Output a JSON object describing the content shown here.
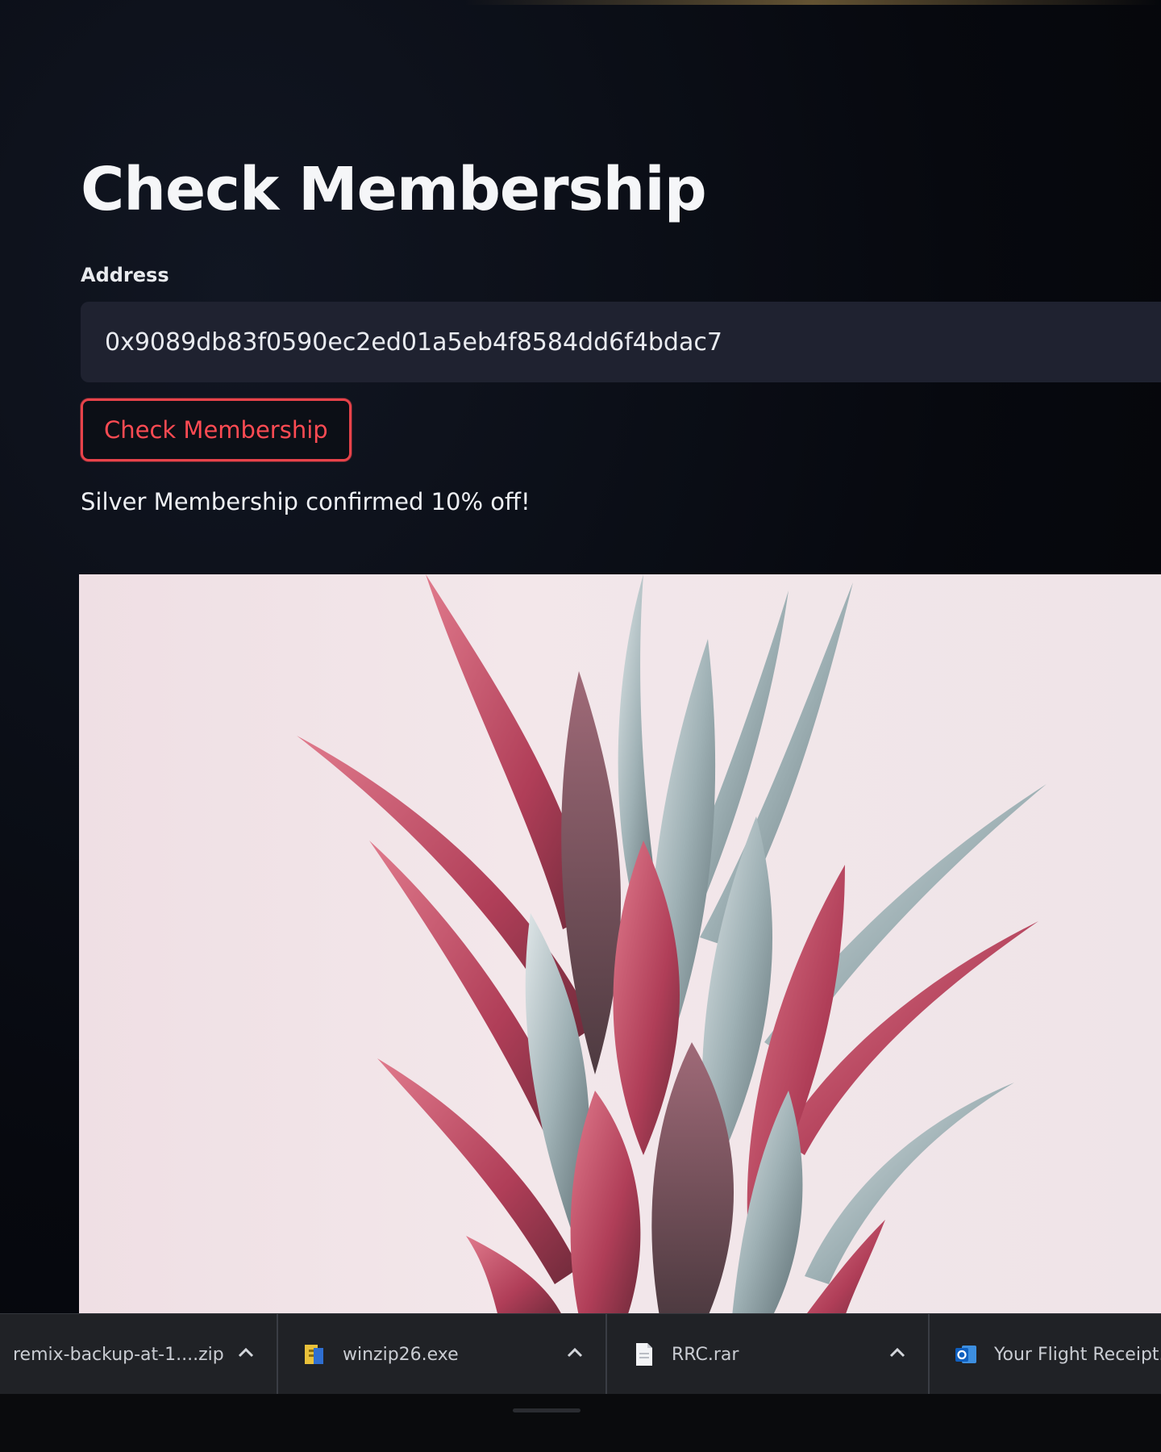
{
  "page": {
    "title": "Check Membership"
  },
  "form": {
    "address_label": "Address",
    "address_value": "0x9089db83f0590ec2ed01a5eb4f8584dd6f4bdac7",
    "check_button_label": "Check Membership"
  },
  "result": {
    "message": "Silver Membership confirmed 10% off!"
  },
  "image": {
    "subject": "pineapple crown"
  },
  "downloads": [
    {
      "name": "remix-backup-at-1....zip",
      "icon": "zip-icon"
    },
    {
      "name": "winzip26.exe",
      "icon": "winzip-icon"
    },
    {
      "name": "RRC.rar",
      "icon": "document-icon"
    },
    {
      "name": "Your Flight Receipt....e",
      "icon": "outlook-icon"
    }
  ],
  "colors": {
    "accent": "#e8434a",
    "background": "#07090f",
    "input_bg": "#1f2230"
  }
}
